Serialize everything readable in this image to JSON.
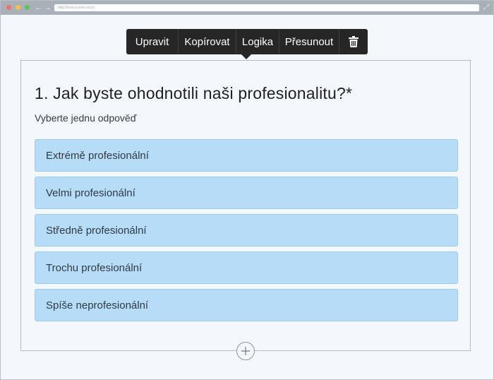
{
  "browser": {
    "url": "http://www.survio.cz/cs/",
    "back_icon": "←",
    "forward_icon": "→",
    "expand_icon": "⤢"
  },
  "toolbar": {
    "edit_label": "Upravit",
    "copy_label": "Kopírovat",
    "logic_label": "Logika",
    "move_label": "Přesunout"
  },
  "question": {
    "title": "1. Jak byste ohodnotili naši profesionalitu?*",
    "hint": "Vyberte jednu odpověď",
    "options": [
      "Extrémě profesionální",
      "Velmi profesionální",
      "Středně profesionální",
      "Trochu profesionální",
      "Spíše neprofesionální"
    ]
  },
  "colors": {
    "option_fill": "#b6dcf7",
    "toolbar_bg": "#262626",
    "page_bg": "#f3f8fd"
  }
}
